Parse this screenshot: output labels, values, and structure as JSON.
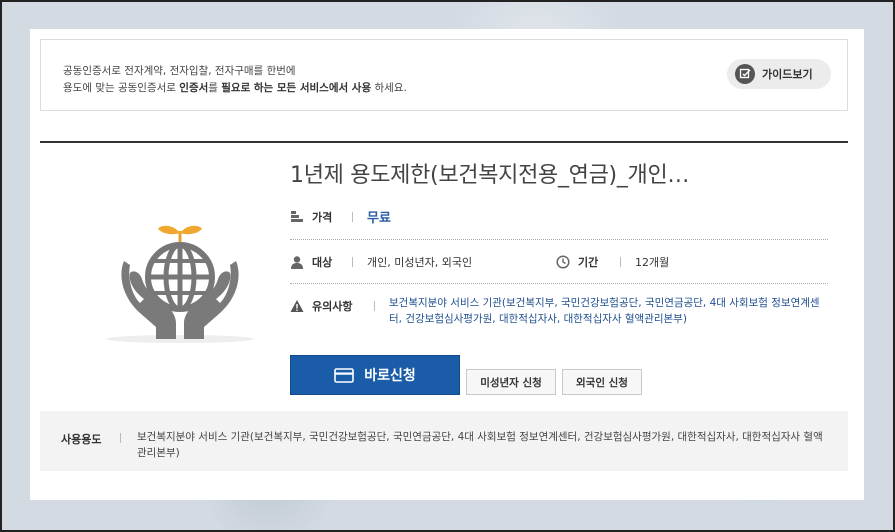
{
  "notice": {
    "line1": "공동인증서로 전자계약, 전자입찰, 전자구매를 한번에",
    "line2_prefix": "용도에 맞는 공동인증서로 ",
    "line2_bold1": "인증서",
    "line2_mid": "를 ",
    "line2_bold2": "필요로 하는 모든 서비스에서 사용",
    "line2_suffix": " 하세요.",
    "guide_button": "가이드보기",
    "guide_icon": "edit-check-icon"
  },
  "product": {
    "title": "1년제 용도제한(보건복지전용_연금)_개인…",
    "icon": "globe-hands-sprout-icon",
    "price_label": "가격",
    "price_value": "무료",
    "target_label": "대상",
    "target_value": "개인, 미성년자, 외국인",
    "period_label": "기간",
    "period_value": "12개월",
    "caution_label": "유의사항",
    "caution_text": "보건복지분야 서비스 기관(보건복지부, 국민건강보험공단, 국민연금공단, 4대 사회보험 정보연계센터, 건강보험심사평가원, 대한적십자사, 대한적십자사 혈액관리본부)",
    "apply_button": "바로신청",
    "minor_button": "미성년자 신청",
    "foreigner_button": "외국인 신청"
  },
  "usage": {
    "label": "사용용도",
    "text": "보건복지분야 서비스 기관(보건복지부, 국민건강보험공단, 국민연금공단, 4대 사회보험 정보연계센터, 건강보험심사평가원, 대한적십자사, 대한적십자사 혈액관리본부)"
  },
  "colors": {
    "accent": "#1a5ca8",
    "link": "#2a5da8",
    "sprout": "#f0a830"
  }
}
